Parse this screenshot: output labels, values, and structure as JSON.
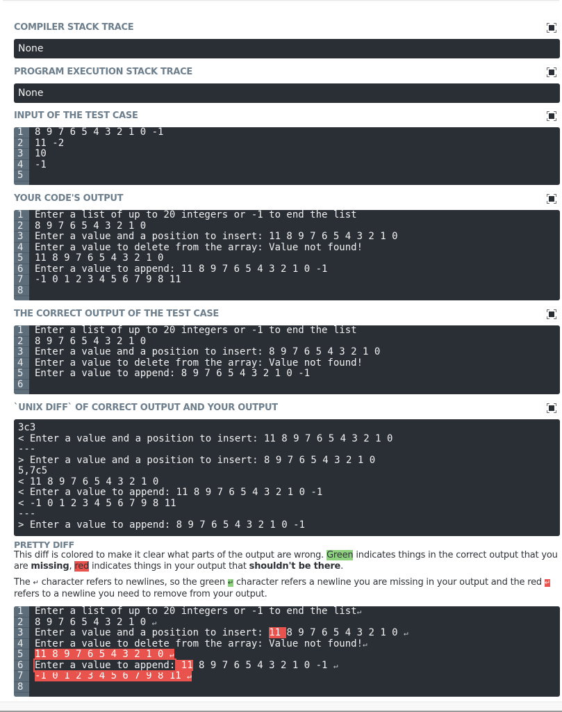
{
  "sections": {
    "compiler": {
      "title": "COMPILER STACK TRACE",
      "value": "None"
    },
    "execution": {
      "title": "PROGRAM EXECUTION STACK TRACE",
      "value": "None"
    },
    "input": {
      "title": "INPUT OF THE TEST CASE",
      "lines": [
        "8 9 7 6 5 4 3 2 1 0 -1",
        "11 -2",
        "10",
        "-1",
        ""
      ]
    },
    "your_output": {
      "title": "YOUR CODE'S OUTPUT",
      "lines": [
        "Enter a list of up to 20 integers or -1 to end the list",
        "8 9 7 6 5 4 3 2 1 0",
        "Enter a value and a position to insert: 11 8 9 7 6 5 4 3 2 1 0",
        "Enter a value to delete from the array: Value not found!",
        "11 8 9 7 6 5 4 3 2 1 0",
        "Enter a value to append: 11 8 9 7 6 5 4 3 2 1 0 -1",
        "-1 0 1 2 3 4 5 6 7 9 8 11",
        ""
      ]
    },
    "correct_output": {
      "title": "THE CORRECT OUTPUT OF THE TEST CASE",
      "lines": [
        "Enter a list of up to 20 integers or -1 to end the list",
        "8 9 7 6 5 4 3 2 1 0",
        "Enter a value and a position to insert: 8 9 7 6 5 4 3 2 1 0",
        "Enter a value to delete from the array: Value not found!",
        "Enter a value to append: 8 9 7 6 5 4 3 2 1 0 -1",
        ""
      ]
    },
    "unix_diff": {
      "title": "`UNIX DIFF` OF CORRECT OUTPUT AND YOUR OUTPUT",
      "lines": [
        "3c3",
        "< Enter a value and a position to insert: 11 8 9 7 6 5 4 3 2 1 0",
        "---",
        "> Enter a value and a position to insert: 8 9 7 6 5 4 3 2 1 0",
        "5,7c5",
        "< 11 8 9 7 6 5 4 3 2 1 0",
        "< Enter a value to append: 11 8 9 7 6 5 4 3 2 1 0 -1",
        "< -1 0 1 2 3 4 5 6 7 9 8 11",
        "---",
        "> Enter a value to append: 8 9 7 6 5 4 3 2 1 0 -1"
      ]
    },
    "pretty_diff": {
      "title": "PRETTY DIFF",
      "para1": {
        "a": "This diff is colored to make it clear what parts of the output are wrong. ",
        "green": "Green",
        "b": " indicates things in the correct output that you are ",
        "missing": "missing",
        "c": ", ",
        "red": "red",
        "d": " indicates things in your output that ",
        "shouldnt": "shouldn't be there",
        "e": "."
      },
      "para2": {
        "a": "The ",
        "nl": "↵",
        "b": " character refers to newlines, so the green ",
        "c": " character refers a newline you are missing in your output and the red ",
        "d": " refers to a newline you need to remove from your output."
      },
      "newline_glyph": "↵",
      "lines": {
        "l1": "Enter a list of up to 20 integers or -1 to end the list",
        "l2": "8 9 7 6 5 4 3 2 1 0 ",
        "l3a": "Enter a value and a position to insert: ",
        "l3red": "11 ",
        "l3b": "8 9 7 6 5 4 3 2 1 0 ",
        "l4": "Enter a value to delete from the array: Value not found!",
        "l5red": "11 8 9 7 6 5 4 3 2 1 0 ",
        "l6a": "Enter a value to append:",
        "l6red": " 11",
        "l6b": " 8 9 7 6 5 4 3 2 1 0 -1 ",
        "l7red": "-1 0 1 2 3 4 5 6 7 9 8 11 ",
        "l8": ""
      }
    }
  },
  "colors": {
    "red": "#e9534d",
    "green": "#8ed17f",
    "code_bg": "#2a2f36",
    "gutter": "#5d6d7a",
    "heading": "#6d7e8c"
  }
}
